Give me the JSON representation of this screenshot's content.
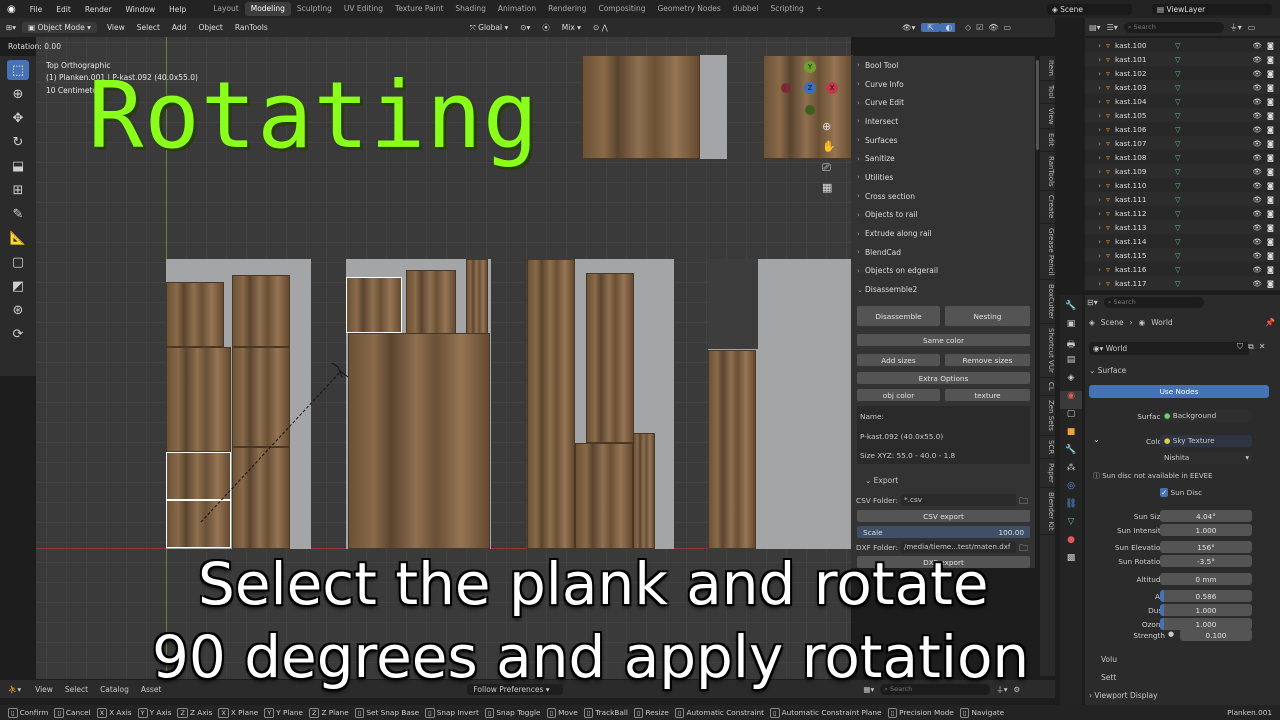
{
  "topbar": {
    "menus": [
      "File",
      "Edit",
      "Render",
      "Window",
      "Help"
    ],
    "workspaces": [
      "Layout",
      "Modeling",
      "Sculpting",
      "UV Editing",
      "Texture Paint",
      "Shading",
      "Animation",
      "Rendering",
      "Compositing",
      "Geometry Nodes",
      "dubbel",
      "Scripting"
    ],
    "active_workspace": "Modeling",
    "add_tab": "+",
    "scene_label": "Scene",
    "viewlayer_label": "ViewLayer"
  },
  "viewport_header": {
    "mode": "Object Mode",
    "menus": [
      "View",
      "Select",
      "Add",
      "Object",
      "RanTools"
    ],
    "orientation": "Global",
    "pivot": "Mix"
  },
  "viewport": {
    "operator_status": "Rotation: 0.00",
    "view_name": "Top Orthographic",
    "object_info": "(1) Planken.001 | P-kast.092 (40.0x55.0)",
    "scale_info": "10 Centimeters",
    "gizmo_axes": {
      "y": "Y",
      "x": "X",
      "z": "Z"
    }
  },
  "overlay": {
    "title": "Rotating",
    "caption_line1": "Select the plank and rotate",
    "caption_line2": "90 degrees and apply rotation"
  },
  "npanel": {
    "items": [
      "Bool Tool",
      "Curve Info",
      "Curve Edit",
      "Intersect",
      "Surfaces",
      "Sanitize",
      "Utilities",
      "Cross section",
      "Objects to rail",
      "Extrude along rail",
      "BlendCad",
      "Objects on edgerail",
      "Disassemble2"
    ],
    "buttons": {
      "disassemble": "Disassemble",
      "nesting": "Nesting",
      "same_color": "Same color",
      "add_sizes": "Add sizes",
      "remove_sizes": "Remove sizes",
      "extra_options": "Extra Options",
      "obj_color": "obj color",
      "texture": "texture"
    },
    "name_label": "Name:",
    "name_value": "P-kast.092 (40.0x55.0)",
    "size_value": "Size XYZ: 55.0  -  40.0  -  1.8",
    "export_header": "Export",
    "csv_folder_label": "CSV Folder:",
    "csv_folder_value": "*.csv",
    "csv_export": "CSV export",
    "scale_label": "Scale",
    "scale_value": "100.00",
    "dxf_folder_label": "DXF Folder:",
    "dxf_folder_value": "/media/tieme...test/maten.dxf",
    "dxf_export": "DXF export"
  },
  "vtabs": [
    "Item",
    "Tool",
    "View",
    "Edit",
    "RanTools",
    "Create",
    "Grease Pencil",
    "BoxCutter",
    "Shortcut VUr",
    "CL",
    "Zen Sets",
    "SCR",
    "Paper",
    "Blender Kit"
  ],
  "outliner": {
    "search_placeholder": "Search",
    "items": [
      "kast.100",
      "kast.101",
      "kast.102",
      "kast.103",
      "kast.104",
      "kast.105",
      "kast.106",
      "kast.107",
      "kast.108",
      "kast.109",
      "kast.110",
      "kast.111",
      "kast.112",
      "kast.113",
      "kast.114",
      "kast.115",
      "kast.116",
      "kast.117"
    ]
  },
  "properties": {
    "search_placeholder": "Search",
    "breadcrumb_scene": "Scene",
    "breadcrumb_world": "World",
    "world_name": "World",
    "surface_header": "Surface",
    "use_nodes": "Use Nodes",
    "surface_label": "Surface",
    "surface_value": "Background",
    "color_label": "Color",
    "color_value": "Sky Texture",
    "sky_type": "Nishita",
    "eevee_warning": "Sun disc not available in EEVEE",
    "sun_disc_label": "Sun Disc",
    "fields": [
      {
        "label": "Sun Size",
        "value": "4.04°"
      },
      {
        "label": "Sun Intensity",
        "value": "1.000"
      },
      {
        "label": "Sun Elevation",
        "value": "156°"
      },
      {
        "label": "Sun Rotation",
        "value": "-3.5°"
      },
      {
        "label": "Altitude",
        "value": "0 mm"
      },
      {
        "label": "Air",
        "value": "0.586"
      },
      {
        "label": "Dust",
        "value": "1.000"
      },
      {
        "label": "Ozone",
        "value": "1.000"
      }
    ],
    "strength_label": "Strength",
    "strength_value": "0.100",
    "volume_label": "Volu",
    "settings_label": "Sett",
    "viewport_display": "Viewport Display"
  },
  "timeline": {
    "menus": [
      "View",
      "Select",
      "Catalog",
      "Asset"
    ],
    "follow": "Follow Preferences",
    "search_placeholder": "Search"
  },
  "statusbar": {
    "items": [
      "Confirm",
      "Cancel",
      "X Axis",
      "Y Axis",
      "Z Axis",
      "X Plane",
      "Y Plane",
      "Z Plane",
      "Set Snap Base",
      "Snap Invert",
      "Snap Toggle",
      "Move",
      "TrackBall",
      "Resize",
      "Automatic Constraint",
      "Automatic Constraint Plane",
      "Precision Mode",
      "Navigate"
    ],
    "keys": [
      "X",
      "Y",
      "Z",
      "X",
      "Y",
      "Z"
    ],
    "object_name": "Planken.001"
  },
  "colors": {
    "accent": "#4772b3",
    "overlay_green": "#8bff1c",
    "selection": "#ffffff"
  }
}
